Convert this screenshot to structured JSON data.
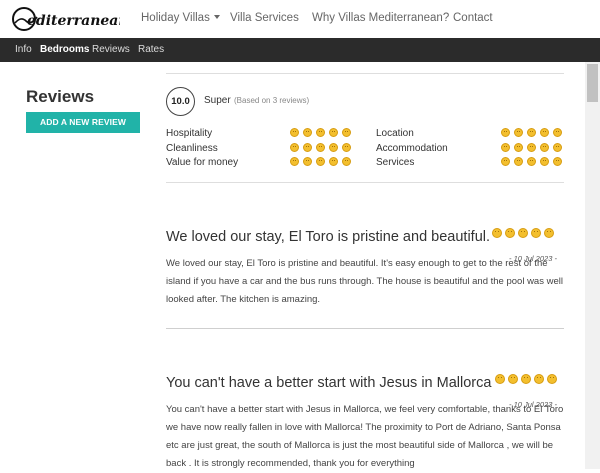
{
  "brand": {
    "logo_text": "Mediterranean",
    "accent": "#21b3a8"
  },
  "topnav": {
    "items": [
      {
        "label": "Holiday Villas",
        "has_dropdown": true
      },
      {
        "label": "Villa Services"
      },
      {
        "label": "Why Villas Mediterranean?"
      },
      {
        "label": "Contact"
      }
    ]
  },
  "subnav": {
    "items": [
      {
        "label": "Info"
      },
      {
        "label": "Bedrooms",
        "active": true
      },
      {
        "label": "Reviews"
      },
      {
        "label": "Rates"
      }
    ]
  },
  "sidebar": {
    "title": "Reviews",
    "add_button": "ADD A NEW REVIEW"
  },
  "summary": {
    "score": "10.0",
    "label": "Super",
    "based_on": "(Based on 3 reviews)",
    "categories": [
      {
        "name": "Hospitality",
        "rating": 5
      },
      {
        "name": "Location",
        "rating": 5
      },
      {
        "name": "Cleanliness",
        "rating": 5
      },
      {
        "name": "Accommodation",
        "rating": 5
      },
      {
        "name": "Value for money",
        "rating": 5
      },
      {
        "name": "Services",
        "rating": 5
      }
    ]
  },
  "reviews": [
    {
      "title": "We loved our stay, El Toro is pristine and beautiful.",
      "rating": 5,
      "date": "- 10 Jul 2023 -",
      "body": "We loved our stay, El Toro is pristine and beautiful. It's easy enough to get to the rest of the island if you have a car and the bus runs through. The house is beautiful and the pool was well looked after. The kitchen is amazing."
    },
    {
      "title": "You can't have a better start with Jesus in Mallorca",
      "rating": 5,
      "date": "- 10 Jul 2023 -",
      "body": "You can't have a better start with Jesus in Mallorca, we feel very comfortable, thanks to El Toro we have now really fallen in love with Mallorca! The proximity to Port de Adriano, Santa Ponsa etc are just great, the south of Mallorca is just the most beautiful side of Mallorca , we will be back . It is strongly recommended, thank you for everything"
    }
  ]
}
